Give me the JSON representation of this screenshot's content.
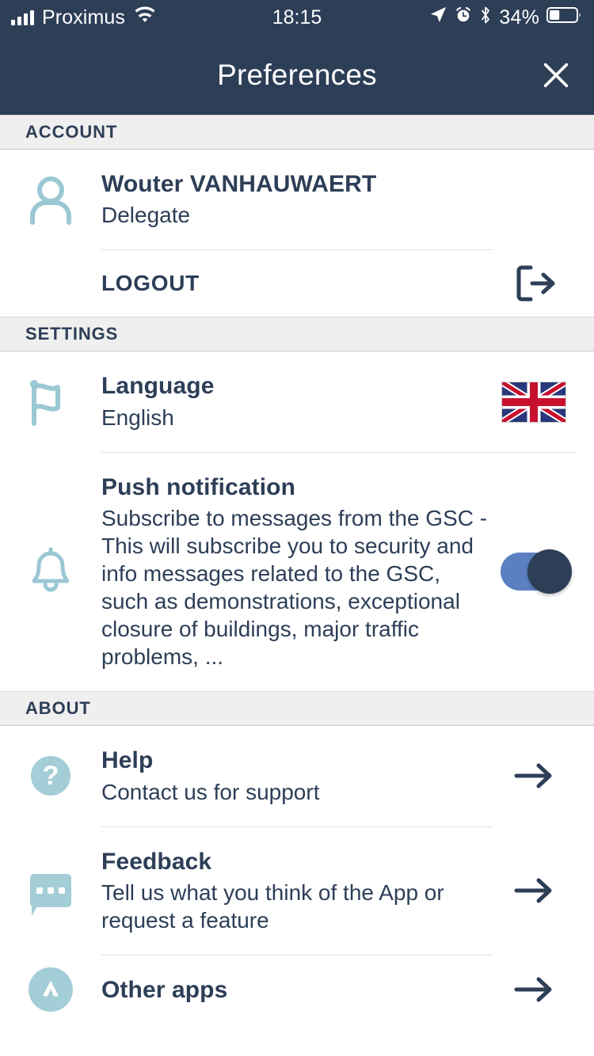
{
  "status_bar": {
    "carrier": "Proximus",
    "time": "18:15",
    "battery_percent": "34%",
    "battery_level": 34,
    "icons": [
      "signal-bars-icon",
      "wifi-icon",
      "location-arrow-icon",
      "alarm-clock-icon",
      "bluetooth-icon",
      "battery-icon"
    ]
  },
  "nav": {
    "title": "Preferences",
    "close_icon": "close-icon"
  },
  "colors": {
    "header_bg": "#2d3e57",
    "section_bg": "#efefef",
    "text_primary": "#2d3e57",
    "accent_teal": "#a3cdd7",
    "toggle_track": "#5b7fc0",
    "toggle_knob": "#2d3e57",
    "divider": "#e2e2e2"
  },
  "sections": [
    {
      "header": "ACCOUNT",
      "rows": [
        {
          "icon": "person-icon",
          "title": "Wouter VANHAUWAERT",
          "subtitle": "Delegate",
          "action": "none"
        },
        {
          "icon": "none",
          "title": "LOGOUT",
          "subtitle": "",
          "action": "logout-icon"
        }
      ]
    },
    {
      "header": "SETTINGS",
      "rows": [
        {
          "icon": "flag-icon",
          "title": "Language",
          "subtitle": "English",
          "action": "uk-flag"
        },
        {
          "icon": "bell-icon",
          "title": "Push notification",
          "subtitle": "Subscribe to messages from the GSC - This will subscribe you to security and info messages related to the GSC, such as demonstrations, exceptional closure of buildings, major traffic problems, ...",
          "action": "toggle",
          "toggle_on": true
        }
      ]
    },
    {
      "header": "ABOUT",
      "rows": [
        {
          "icon": "help-question-icon",
          "title": "Help",
          "subtitle": "Contact us for support",
          "action": "arrow-right-icon"
        },
        {
          "icon": "feedback-bubble-icon",
          "title": "Feedback",
          "subtitle": "Tell us what you think of the App or request a feature",
          "action": "arrow-right-icon"
        },
        {
          "icon": "other-apps-icon",
          "title": "Other apps",
          "subtitle": "",
          "action": "arrow-right-icon"
        }
      ]
    }
  ]
}
